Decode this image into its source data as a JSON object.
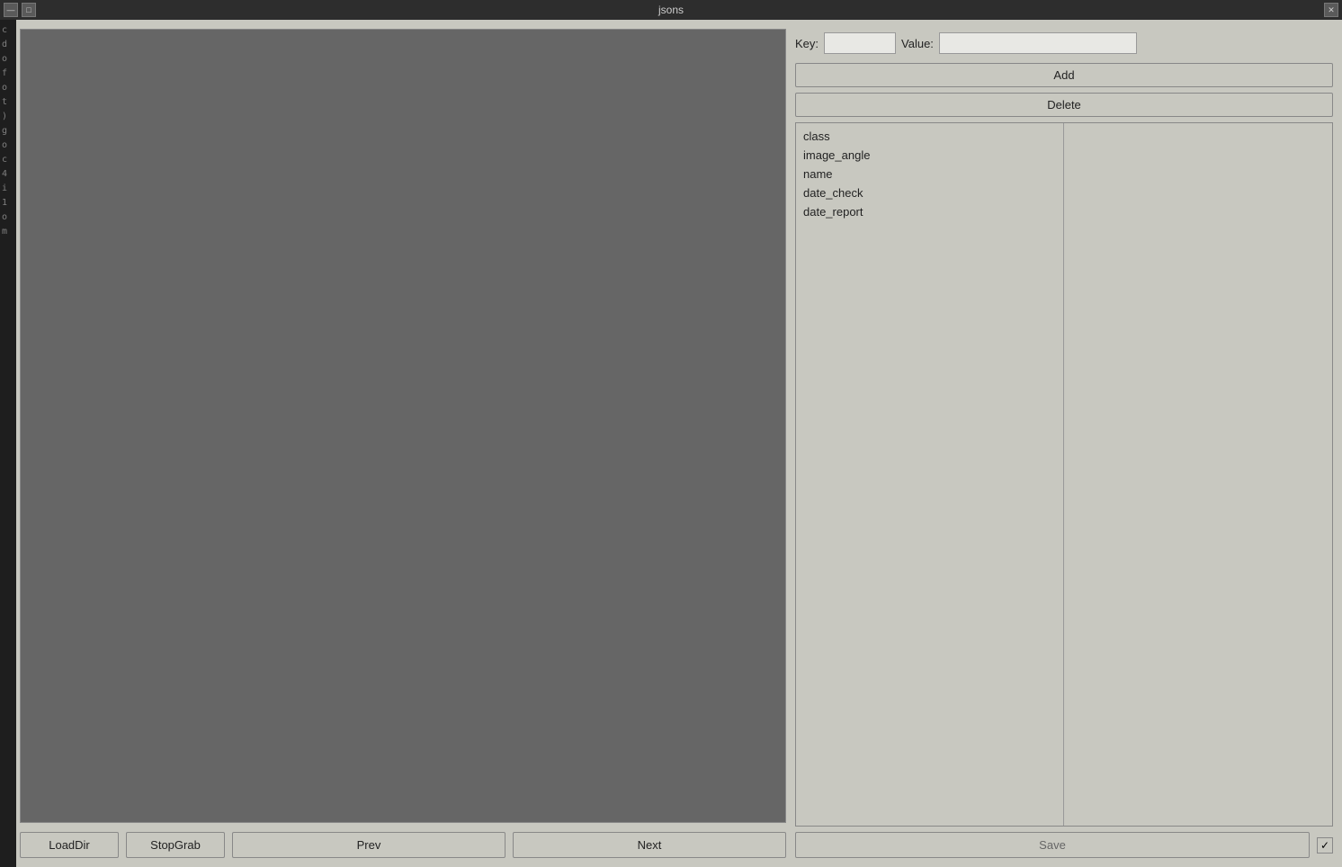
{
  "titlebar": {
    "title": "jsons",
    "minimize_label": "—",
    "maximize_label": "□",
    "close_label": "✕"
  },
  "toolbar": {
    "key_label": "Key:",
    "value_label": "Value:",
    "key_placeholder": "",
    "value_placeholder": "",
    "add_label": "Add",
    "delete_label": "Delete",
    "save_label": "Save"
  },
  "fields": {
    "keys": [
      "class",
      "image_angle",
      "name",
      "date_check",
      "date_report"
    ],
    "values": []
  },
  "bottom_buttons": {
    "loaddir_label": "LoadDir",
    "stopgrab_label": "StopGrab",
    "prev_label": "Prev",
    "next_label": "Next"
  },
  "checkbox": {
    "checked": true,
    "symbol": "✓"
  }
}
